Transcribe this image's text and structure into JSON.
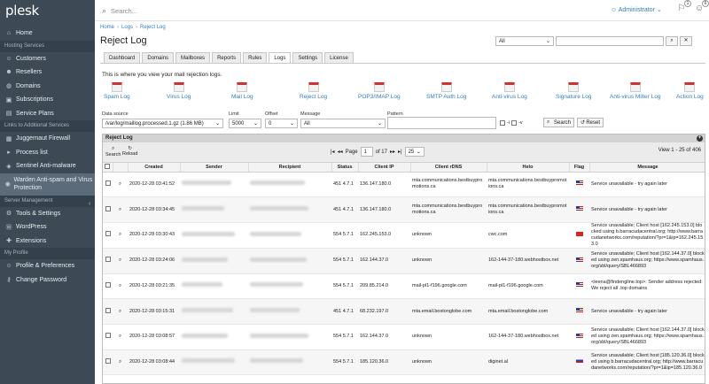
{
  "app": {
    "logo": "plesk"
  },
  "sidebar": {
    "items_top": [
      {
        "label": "Home",
        "icon": "home-icon",
        "glyph": "⌂"
      }
    ],
    "sections": [
      {
        "title": "Hosting Services",
        "items": [
          {
            "label": "Customers",
            "icon": "users-icon",
            "glyph": "☺"
          },
          {
            "label": "Resellers",
            "icon": "resellers-icon",
            "glyph": "☻"
          },
          {
            "label": "Domains",
            "icon": "globe-icon",
            "glyph": "◍"
          },
          {
            "label": "Subscriptions",
            "icon": "subscriptions-icon",
            "glyph": "▣"
          },
          {
            "label": "Service Plans",
            "icon": "plans-icon",
            "glyph": "▤"
          }
        ]
      },
      {
        "title": "Links to Additional Services",
        "items": [
          {
            "label": "Juggernaut Firewall",
            "icon": "firewall-icon",
            "glyph": "▦"
          },
          {
            "label": "Process list",
            "icon": "process-icon",
            "glyph": "▸"
          },
          {
            "label": "Sentinel Anti-malware",
            "icon": "shield-icon",
            "glyph": "◈"
          },
          {
            "label": "Warden Anti-spam and Virus Protection",
            "icon": "warden-icon",
            "glyph": "◉",
            "active": true
          }
        ]
      },
      {
        "title": "Server Management",
        "items": [
          {
            "label": "Tools & Settings",
            "icon": "tools-icon",
            "glyph": "⚙"
          },
          {
            "label": "WordPress",
            "icon": "wordpress-icon",
            "glyph": "Ⓦ"
          },
          {
            "label": "Extensions",
            "icon": "extensions-icon",
            "glyph": "✚"
          }
        ]
      },
      {
        "title": "My Profile",
        "items": [
          {
            "label": "Profile & Preferences",
            "icon": "profile-icon",
            "glyph": "☺"
          },
          {
            "label": "Change Password",
            "icon": "key-icon",
            "glyph": "⚷"
          }
        ]
      }
    ]
  },
  "topbar": {
    "search_placeholder": "Search...",
    "user": "Administrator",
    "badge1": "1",
    "badge2": "6"
  },
  "breadcrumbs": [
    "Home",
    "Logs",
    "Reject Log"
  ],
  "page_title": "Reject Log",
  "right_search": {
    "filter": "All",
    "value": ""
  },
  "tabs": [
    "Dashboard",
    "Domains",
    "Mailboxes",
    "Reports",
    "Rules",
    "Logs",
    "Settings",
    "License"
  ],
  "active_tab": "Logs",
  "intro": "This is where you view your mail rejection logs.",
  "log_types": [
    "Spam Log",
    "Virus Log",
    "Mail Log",
    "Reject Log",
    "POP3/IMAP Log",
    "SMTP Auth Log",
    "Anti-virus Log",
    "Signature Log",
    "Anti-virus Milter Log",
    "Action Log"
  ],
  "filters": {
    "data_source_label": "Data source",
    "data_source": "/var/log/maillog.processed.1.gz (1.86 MB)",
    "limit_label": "Limit",
    "limit": "5000",
    "offset_label": "Offset",
    "offset": "0",
    "message_label": "Message",
    "message": "All",
    "pattern_label": "Pattern",
    "pattern": "",
    "i_label": "-i",
    "v_label": "-v",
    "search_label": "Search",
    "reset_label": "Reset"
  },
  "grid": {
    "title": "Reject Log",
    "search": "Search",
    "reload": "Reload",
    "page_label": "Page",
    "page": "1",
    "of_pages": "of 17",
    "page_size": "25",
    "view_info": "View 1 - 25 of 406",
    "columns": [
      "",
      "",
      "Created",
      "Sender",
      "Recipient",
      "Status",
      "Client IP",
      "Client rDNS",
      "Helo",
      "Flag",
      "Message"
    ],
    "rows": [
      {
        "created": "2020-12-28 03:41:52",
        "status": "451 4.7.1",
        "ip": "136.147.180.0",
        "rdns": "mta.communications.bestbuypromotions.ca",
        "helo": "mta.communications.bestbuypromotions.ca",
        "flag": "us",
        "message": "Service unavailable - try again later"
      },
      {
        "created": "2020-12-28 03:34:45",
        "status": "451 4.7.1",
        "ip": "136.147.180.0",
        "rdns": "mta.communications.bestbuypromotions.ca",
        "helo": "mta.communications.bestbuypromotions.ca",
        "flag": "us",
        "message": "Service unavailable - try again later"
      },
      {
        "created": "2020-12-28 03:30:43",
        "status": "554 5.7.1",
        "ip": "162.245.153.0",
        "rdns": "unknown",
        "helo": "cwc.com",
        "flag": "ch",
        "message": "Service unavailable; Client host [162.245.153.0] blocked using b.barracudacentral.org; http://www.barracudanetworks.com/reputation/?pr=1&ip=162.245.153.0"
      },
      {
        "created": "2020-12-28 03:24:06",
        "status": "554 5.7.1",
        "ip": "162.144.37.0",
        "rdns": "unknown",
        "helo": "162-144-37-180.webhostbox.net",
        "flag": "us",
        "message": "Service unavailable; Client host [162.144.37.0] blocked using zen.spamhaus.org; https://www.spamhaus.org/sbl/query/SBL466893"
      },
      {
        "created": "2020-12-28 03:21:35",
        "status": "554 5.7.1",
        "ip": "209.85.214.0",
        "rdns": "mail-pl1-f196.google.com",
        "helo": "mail-pl1-f196.google.com",
        "flag": "us",
        "message": "<leena@findengline.top>: Sender address rejected: We reject all .top domains"
      },
      {
        "created": "2020-12-28 03:15:31",
        "status": "451 4.7.1",
        "ip": "68.232.197.0",
        "rdns": "mta.email.bostonglobe.com",
        "helo": "mta.email.bostonglobe.com",
        "flag": "us",
        "message": "Service unavailable - try again later"
      },
      {
        "created": "2020-12-28 03:08:57",
        "status": "554 5.7.1",
        "ip": "162.144.37.0",
        "rdns": "unknown",
        "helo": "162-144-37-180.webhostbox.net",
        "flag": "us",
        "message": "Service unavailable; Client host [162.144.37.0] blocked using zen.spamhaus.org; https://www.spamhaus.org/sbl/query/SBL466893"
      },
      {
        "created": "2020-12-28 03:08:44",
        "status": "554 5.7.1",
        "ip": "185.120.36.0",
        "rdns": "unknown",
        "helo": "diginet.al",
        "flag": "ru",
        "message": "Service unavailable; Client host [185.120.36.0] blocked using b.barracudacentral.org; http://www.barracudanetworks.com/reputation/?pr=1&ip=185.120.36.0"
      }
    ]
  }
}
